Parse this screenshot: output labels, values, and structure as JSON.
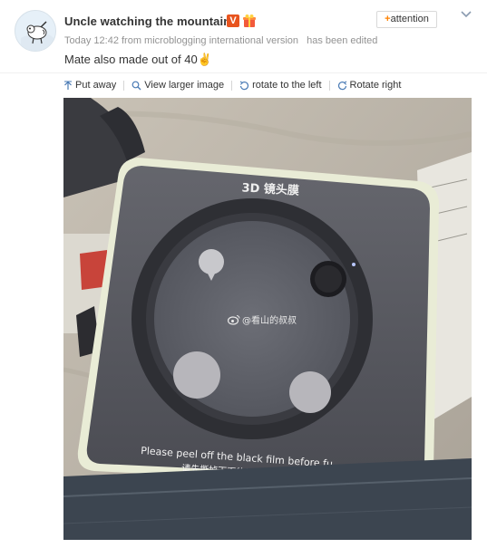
{
  "post": {
    "author": "Uncle watching the mountain",
    "verified_badge": "V",
    "meta": {
      "time": "Today 12:42",
      "source": "from microblogging international version",
      "edited": "has been edited"
    },
    "follow_label": "attention",
    "follow_prefix": "+",
    "text": "Mate also made out of 40",
    "text_emoji": "✌"
  },
  "toolbar": {
    "put_away": "Put away",
    "view_larger": "View larger image",
    "rotate_left": "rotate to the left",
    "rotate_right": "Rotate right"
  },
  "photo": {
    "lens_title": "3D 镜头膜",
    "watermark": "@看山的叔叔",
    "peel_text_en": "Please peel off the black film before fu",
    "peel_text_cn": "请先撕掉下面的黑色"
  },
  "colors": {
    "accent_orange": "#ff8200",
    "verified_orange": "#e8541e",
    "meta_gray": "#939393"
  },
  "icons": [
    "avatar",
    "verified-v-icon",
    "gift-icon",
    "chevron-down-icon",
    "arrow-up-icon",
    "magnifier-icon",
    "rotate-left-icon",
    "rotate-right-icon",
    "weibo-icon"
  ]
}
